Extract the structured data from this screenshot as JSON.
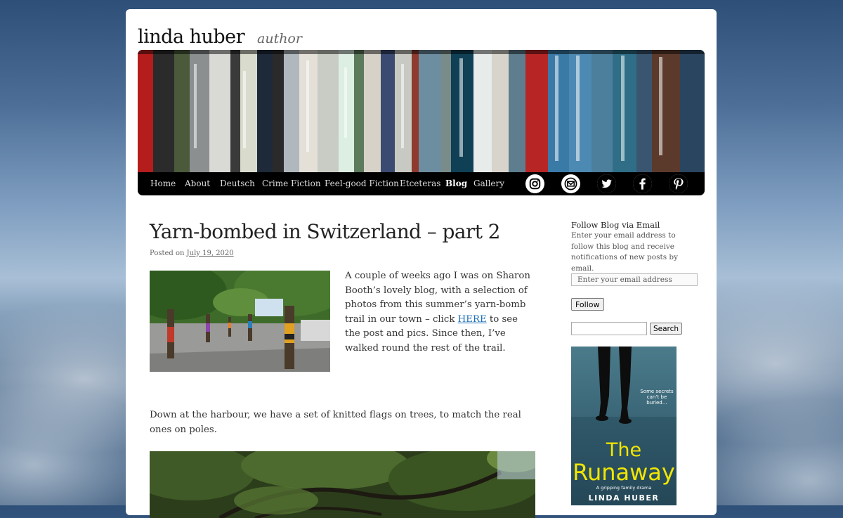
{
  "site": {
    "title": "linda huber",
    "tagline": "author"
  },
  "nav": {
    "items": [
      {
        "label": "Home"
      },
      {
        "label": "About"
      },
      {
        "label": "Deutsch"
      },
      {
        "label": "Crime Fiction"
      },
      {
        "label": "Feel-good Fiction"
      },
      {
        "label": "Etceteras"
      },
      {
        "label": "Blog"
      },
      {
        "label": "Gallery"
      }
    ],
    "active": "Blog",
    "social_icons": [
      "instagram-icon",
      "email-icon",
      "twitter-icon",
      "facebook-icon",
      "pinterest-icon"
    ]
  },
  "post": {
    "title": "Yarn-bombed in Switzerland – part 2",
    "posted_on_label": "Posted on",
    "date": "July 19, 2020",
    "para1_before_link": "A couple of weeks ago I was on Sharon Booth’s lovely blog, with a selection of photos from this summer’s yarn-bomb trail in our town – click ",
    "para1_link": "HERE",
    "para1_after_link": " to see the post and pics. Since then, I’ve walked round the rest of the trail.",
    "para2": "Down at the harbour, we have a set of knitted flags on trees, to match the real ones on poles."
  },
  "sidebar": {
    "follow_title": "Follow Blog via Email",
    "follow_text": "Enter your email address to follow this blog and receive notifications of new posts by email.",
    "email_placeholder": "Enter your email address",
    "follow_button": "Follow",
    "search_button": "Search",
    "book": {
      "tagline": "Some secrets can’t be buried…",
      "title_line1": "The",
      "title_line2": "Runaway",
      "subtitle": "A gripping family drama",
      "author": "LINDA HUBER"
    }
  }
}
